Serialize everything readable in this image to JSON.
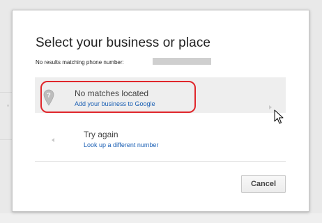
{
  "dialog": {
    "title": "Select your business or place",
    "subtitle": "No results matching phone number:",
    "results": [
      {
        "title": "No matches located",
        "link": "Add your business to Google"
      },
      {
        "title": "Try again",
        "link": "Look up a different number"
      }
    ],
    "cancel_label": "Cancel"
  },
  "colors": {
    "highlight": "#e0262b",
    "link": "#1a5fb4",
    "selected_row": "#eeeeee"
  },
  "icons": [
    "map-pin-icon",
    "chevron-right-icon",
    "chevron-left-icon",
    "mouse-cursor-icon"
  ]
}
